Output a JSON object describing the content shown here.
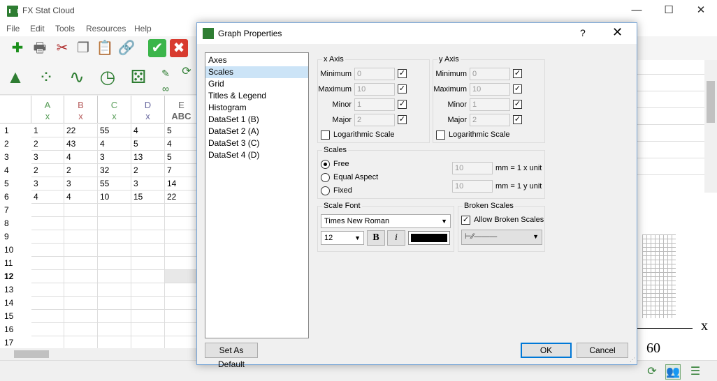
{
  "app": {
    "title": "FX Stat Cloud",
    "menu": [
      "File",
      "Edit",
      "Tools",
      "Resources",
      "Help"
    ],
    "window_buttons": [
      "—",
      "☐",
      "✕"
    ]
  },
  "sheet": {
    "columns": [
      {
        "letter": "A",
        "type": "x",
        "color": "#5a9e5a"
      },
      {
        "letter": "B",
        "type": "x",
        "color": "#b55a5a"
      },
      {
        "letter": "C",
        "type": "x",
        "color": "#5a9e5a"
      },
      {
        "letter": "D",
        "type": "x",
        "color": "#6a6aa0"
      },
      {
        "letter": "E",
        "type": "ABC",
        "color": "#666666"
      }
    ],
    "row_numbers": [
      "1",
      "2",
      "3",
      "4",
      "5",
      "6",
      "7",
      "8",
      "9",
      "10",
      "11",
      "12",
      "13",
      "14",
      "15",
      "16",
      "17"
    ],
    "rows": [
      [
        "1",
        "22",
        "55",
        "4",
        "5"
      ],
      [
        "2",
        "43",
        "4",
        "5",
        "4"
      ],
      [
        "3",
        "4",
        "3",
        "13",
        "5"
      ],
      [
        "2",
        "2",
        "32",
        "2",
        "7"
      ],
      [
        "3",
        "3",
        "55",
        "3",
        "14"
      ],
      [
        "4",
        "4",
        "10",
        "15",
        "22"
      ]
    ]
  },
  "graph": {
    "axis_label": "x",
    "tick_label": "60"
  },
  "dialog": {
    "title": "Graph Properties",
    "help": "?",
    "close": "✕",
    "nav": [
      "Axes",
      "Scales",
      "Grid",
      "Titles & Legend",
      "Histogram",
      "DataSet 1 (B)",
      "DataSet 2 (A)",
      "DataSet 3 (C)",
      "DataSet 4 (D)"
    ],
    "nav_selected": 1,
    "x_axis": {
      "label": "x Axis",
      "minimum_label": "Minimum",
      "minimum": "0",
      "maximum_label": "Maximum",
      "maximum": "10",
      "minor_label": "Minor",
      "minor": "1",
      "major_label": "Major",
      "major": "2",
      "log_label": "Logarithmic Scale"
    },
    "y_axis": {
      "label": "y Axis",
      "minimum_label": "Minimum",
      "minimum": "0",
      "maximum_label": "Maximum",
      "maximum": "10",
      "minor_label": "Minor",
      "minor": "1",
      "major_label": "Major",
      "major": "2",
      "log_label": "Logarithmic Scale"
    },
    "scales": {
      "label": "Scales",
      "free": "Free",
      "equal_aspect": "Equal Aspect",
      "fixed": "Fixed",
      "x_value": "10",
      "x_unit": "mm = 1 x unit",
      "y_value": "10",
      "y_unit": "mm = 1 y unit"
    },
    "scale_font": {
      "label": "Scale Font",
      "font": "Times New Roman",
      "size": "12",
      "bold": "B",
      "italic": "i",
      "color": "#000000"
    },
    "broken_scales": {
      "label": "Broken Scales",
      "allow_label": "Allow Broken Scales",
      "style": "⊢⁄⁄———"
    },
    "buttons": {
      "set_default": "Set As Default",
      "ok": "OK",
      "cancel": "Cancel"
    }
  }
}
